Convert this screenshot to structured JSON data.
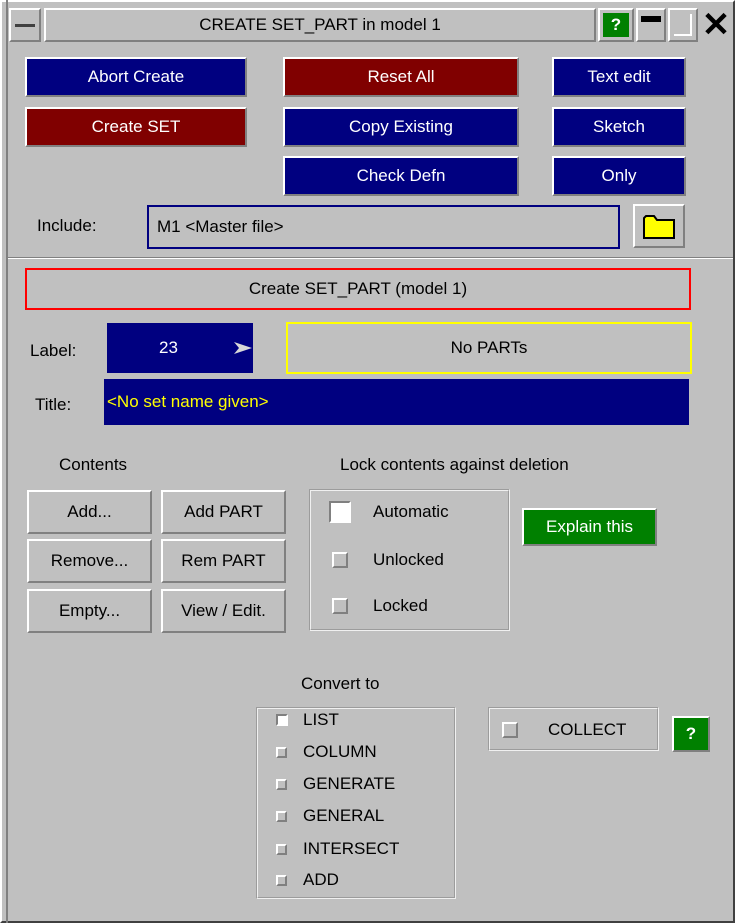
{
  "window": {
    "title": "CREATE SET_PART in model 1",
    "help_glyph": "?"
  },
  "toolbar": {
    "abort_create": "Abort Create",
    "reset_all": "Reset All",
    "text_edit": "Text edit",
    "create_set": "Create SET",
    "copy_existing": "Copy Existing",
    "sketch": "Sketch",
    "check_defn": "Check Defn",
    "only": "Only"
  },
  "include": {
    "label": "Include:",
    "value": "M1  <Master file>"
  },
  "header": {
    "title": "Create SET_PART (model 1)"
  },
  "label_field": {
    "label": "Label:",
    "value": "23",
    "status": "No PARTs"
  },
  "title_field": {
    "label": "Title:",
    "value": "<No set name given>"
  },
  "contents": {
    "heading": "Contents",
    "buttons": [
      "Add...",
      "Add PART",
      "Remove...",
      "Rem PART",
      "Empty...",
      "View / Edit."
    ]
  },
  "lock": {
    "heading": "Lock contents against deletion",
    "options": [
      {
        "label": "Automatic",
        "checked": true
      },
      {
        "label": "Unlocked",
        "checked": false
      },
      {
        "label": "Locked",
        "checked": false
      }
    ],
    "explain": "Explain this"
  },
  "convert": {
    "heading": "Convert to",
    "options": [
      {
        "label": "LIST",
        "checked": true
      },
      {
        "label": "COLUMN",
        "checked": false
      },
      {
        "label": "GENERATE",
        "checked": false
      },
      {
        "label": "GENERAL",
        "checked": false
      },
      {
        "label": "INTERSECT",
        "checked": false
      },
      {
        "label": "ADD",
        "checked": false
      }
    ],
    "collect": "COLLECT",
    "help": "?"
  },
  "colors": {
    "navy": "#000080",
    "maroon": "#800000",
    "green": "#008000",
    "title_text": "#ffff00",
    "highlight_red": "#ff0000",
    "highlight_yellow": "#ffff00"
  }
}
